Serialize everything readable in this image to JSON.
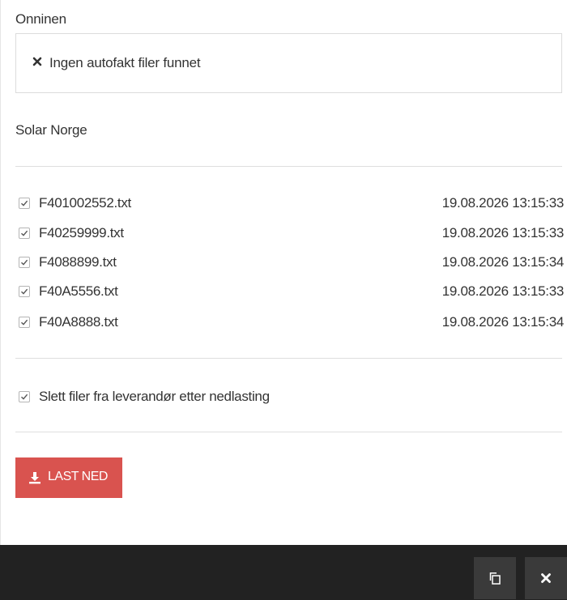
{
  "sections": {
    "onninen": {
      "title": "Onninen",
      "notice": {
        "icon": "close-icon",
        "text": "Ingen autofakt filer funnet"
      }
    },
    "solar": {
      "title": "Solar Norge",
      "files": [
        {
          "name": "F401002552.txt",
          "time": "19.08.2026 13:15:33",
          "checked": true
        },
        {
          "name": "F40259999.txt",
          "time": "19.08.2026 13:15:33",
          "checked": true
        },
        {
          "name": "F4088899.txt",
          "time": "19.08.2026 13:15:34",
          "checked": true
        },
        {
          "name": "F40A5556.txt",
          "time": "19.08.2026 13:15:33",
          "checked": true
        },
        {
          "name": "F40A8888.txt",
          "time": "19.08.2026 13:15:34",
          "checked": true
        }
      ]
    }
  },
  "options": {
    "delete_label": "Slett filer fra leverandør etter nedlasting",
    "delete_checked": true
  },
  "actions": {
    "download_label": "LAST NED",
    "download_icon": "download-icon",
    "download_color": "#d9534f"
  },
  "footer": {
    "copy_icon": "copy-icon",
    "close_icon": "close-icon",
    "background": "#222222"
  }
}
